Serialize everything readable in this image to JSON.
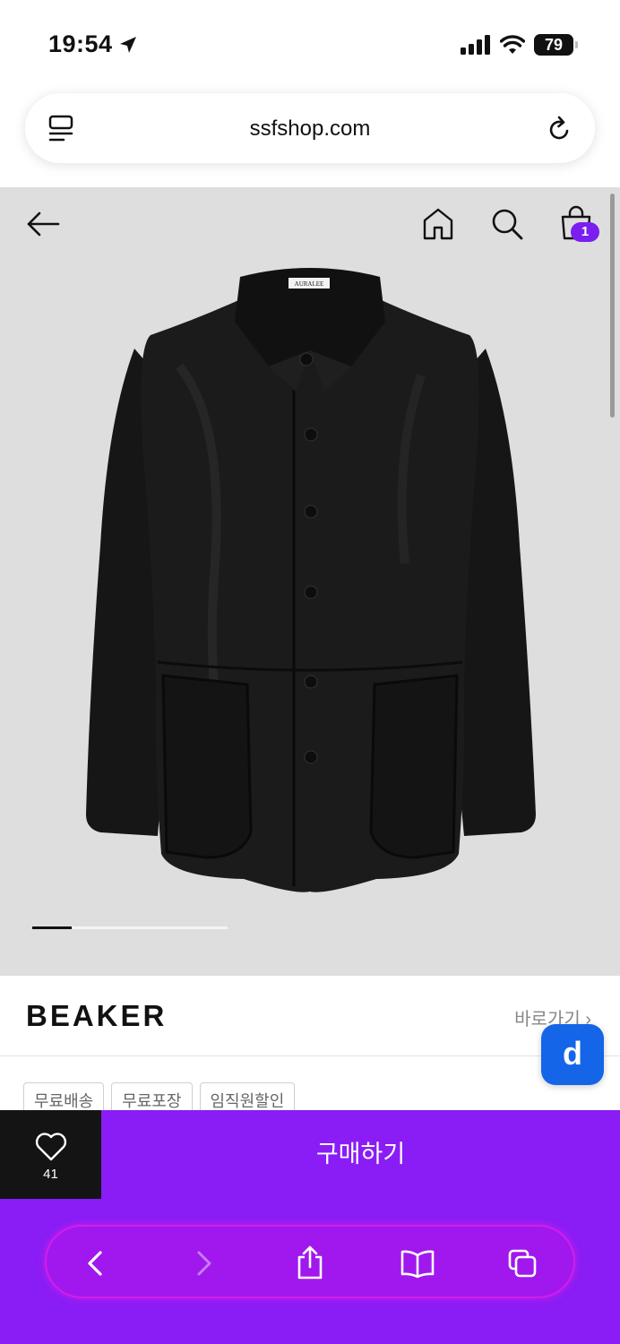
{
  "status_bar": {
    "time": "19:54",
    "battery": "79"
  },
  "url_bar": {
    "url": "ssfshop.com"
  },
  "hero": {
    "product_label": "AURALEE",
    "cart_count": "1",
    "image_index": 1
  },
  "brand": {
    "name": "BEAKER",
    "link_label": "바로가기"
  },
  "floating_badge": {
    "label": "d"
  },
  "tags": [
    "무료배송",
    "무료포장",
    "임직원할인"
  ],
  "buy_bar": {
    "like_count": "41",
    "buy_label": "구매하기"
  },
  "colors": {
    "accent": "#8a1cf5",
    "badge_blue": "#1565e8",
    "hero_bg": "#dedede"
  },
  "toolbar": {
    "icons": [
      "back-icon",
      "forward-icon",
      "share-icon",
      "bookmarks-icon",
      "tabs-icon"
    ]
  }
}
